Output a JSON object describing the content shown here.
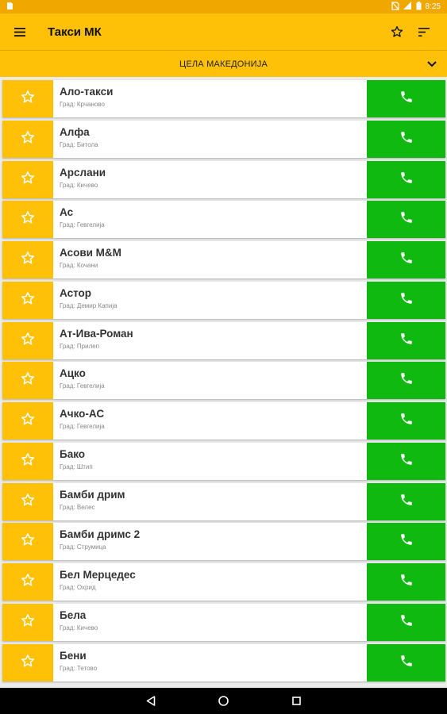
{
  "status_bar": {
    "time": "8:25"
  },
  "app_bar": {
    "title": "Такси МК"
  },
  "region": {
    "label": "ЦЕЛА МАКЕДОНИЈА"
  },
  "colors": {
    "accent": "#ffc107",
    "status": "#f0a800",
    "call": "#10b910"
  },
  "taxis": [
    {
      "name": "Ало-такси",
      "city": "Град: Крчаново"
    },
    {
      "name": "Алфа",
      "city": "Град: Битола"
    },
    {
      "name": "Арслани",
      "city": "Град: Кичево"
    },
    {
      "name": "Ас",
      "city": "Град: Гевгелија"
    },
    {
      "name": "Асови М&М",
      "city": "Град: Кочани"
    },
    {
      "name": "Астор",
      "city": "Град: Демир Капија"
    },
    {
      "name": "Ат-Ива-Роман",
      "city": "Град: Прилеп"
    },
    {
      "name": "Ацко",
      "city": "Град: Гевгелија"
    },
    {
      "name": "Ачко-АС",
      "city": "Град: Гевгелија"
    },
    {
      "name": "Бако",
      "city": "Град: Штип"
    },
    {
      "name": "Бамби дрим",
      "city": "Град: Велес"
    },
    {
      "name": "Бамби дримс 2",
      "city": "Град: Струмица"
    },
    {
      "name": "Бел Мерцедес",
      "city": "Град: Охрид"
    },
    {
      "name": "Бела",
      "city": "Град: Кичево"
    },
    {
      "name": "Бени",
      "city": "Град: Тетово"
    }
  ]
}
